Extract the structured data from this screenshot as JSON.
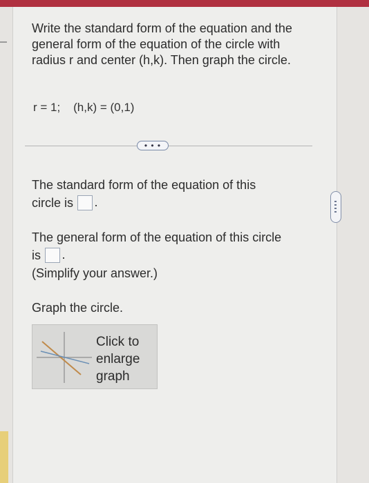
{
  "question": {
    "text": "Write the standard form of the equation and the general form of the equation of the circle with radius r and center (h,k). Then graph the circle.",
    "given": "r = 1;    (h,k) = (0,1)"
  },
  "more_button": {
    "label": "• • •"
  },
  "standard_form": {
    "line1": "The standard form of the equation of this",
    "line2": "circle is"
  },
  "general_form": {
    "line1": "The general form of the equation of this circle",
    "line2": "is",
    "note": "(Simplify your answer.)"
  },
  "graph": {
    "prompt": "Graph the circle.",
    "thumbnail_label": "Click to enlarge graph"
  },
  "colors": {
    "top_bar": "#b03040",
    "accent_box_border": "#9aa5b5",
    "graph_line_1": "#c08a4a",
    "graph_line_2": "#6a8fb5"
  },
  "icons": {
    "more": "ellipsis-icon",
    "scroll": "vertical-ellipsis-icon",
    "graph": "graph-preview-icon"
  }
}
